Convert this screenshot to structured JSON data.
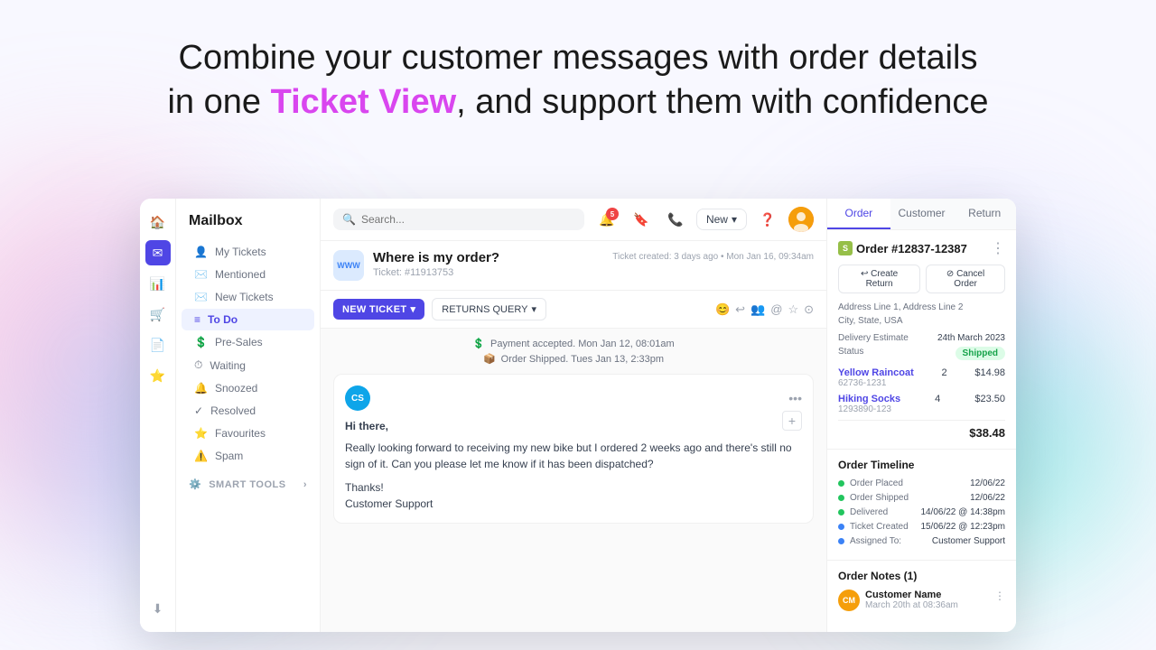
{
  "header": {
    "line1": "Combine your customer messages with order details",
    "line2_start": "in one ",
    "highlight": "Ticket View",
    "line2_end": ", and support them with confidence"
  },
  "sidebar": {
    "title": "Mailbox",
    "items": [
      {
        "id": "my-tickets",
        "label": "My Tickets",
        "icon": "👤"
      },
      {
        "id": "mentioned",
        "label": "Mentioned",
        "icon": "✉️"
      },
      {
        "id": "new-tickets",
        "label": "New Tickets",
        "icon": "✉️"
      },
      {
        "id": "to-do",
        "label": "To Do",
        "icon": "≡",
        "active": true
      },
      {
        "id": "pre-sales",
        "label": "Pre-Sales",
        "icon": "💲"
      },
      {
        "id": "waiting",
        "label": "Waiting",
        "icon": "⏱"
      },
      {
        "id": "snoozed",
        "label": "Snoozed",
        "icon": "🔔"
      },
      {
        "id": "resolved",
        "label": "Resolved",
        "icon": "✓"
      },
      {
        "id": "favourites",
        "label": "Favourites",
        "icon": "⭐"
      },
      {
        "id": "spam",
        "label": "Spam",
        "icon": "⚠️"
      }
    ],
    "smart_tools": "SMART TOOLS"
  },
  "topbar": {
    "search_placeholder": "Search...",
    "notification_count": "5",
    "new_button_label": "New"
  },
  "ticket": {
    "www_badge": "WWW",
    "title": "Where is my order?",
    "id": "Ticket: #11913753",
    "created": "Ticket created: 3 days ago",
    "date": "Mon Jan 16, 09:34am",
    "new_ticket_label": "NEW TICKET",
    "returns_query_label": "RETURNS QUERY",
    "timeline_events": [
      {
        "icon": "$",
        "text": "Payment accepted. Mon Jan 12, 08:01am"
      },
      {
        "icon": "📦",
        "text": "Order Shipped. Tues Jan 13, 2:33pm"
      }
    ],
    "message": {
      "sender_initials": "CS",
      "greeting": "Hi there,",
      "body": "Really looking forward to receiving my new bike but I ordered 2 weeks ago and there's still no sign of it. Can you please let me know if it has been dispatched?",
      "sign_off": "Thanks!",
      "signature": "Customer Support"
    }
  },
  "right_panel": {
    "tabs": [
      {
        "id": "order",
        "label": "Order",
        "active": true
      },
      {
        "id": "customer",
        "label": "Customer"
      },
      {
        "id": "return",
        "label": "Return"
      }
    ],
    "order": {
      "number": "Order #12837-12387",
      "create_return_label": "↩ Create Return",
      "cancel_order_label": "⊘ Cancel Order",
      "address_line1": "Address Line 1, Address Line 2",
      "address_line2": "City, State, USA",
      "delivery_estimate_label": "Delivery Estimate",
      "delivery_estimate_value": "24th March 2023",
      "status_label": "Status",
      "status_value": "Shipped",
      "items": [
        {
          "name": "Yellow Raincoat",
          "sku": "62736-1231",
          "qty": "2",
          "price": "$14.98"
        },
        {
          "name": "Hiking Socks",
          "sku": "1293890-123",
          "qty": "4",
          "price": "$23.50"
        }
      ],
      "total": "$38.48",
      "timeline_title": "Order Timeline",
      "timeline_rows": [
        {
          "label": "Order Placed",
          "value": "12/06/22",
          "color": "green"
        },
        {
          "label": "Order Shipped",
          "value": "12/06/22",
          "color": "green"
        },
        {
          "label": "Delivered",
          "value": "14/06/22 @ 14:38pm",
          "color": "green"
        },
        {
          "label": "Ticket Created",
          "value": "15/06/22 @ 12:23pm",
          "color": "blue"
        },
        {
          "label": "Assigned To:",
          "value": "Customer Support",
          "color": "blue"
        }
      ],
      "notes_title": "Order Notes (1)",
      "note": {
        "initials": "CM",
        "name": "Customer Name",
        "date": "March 20th at 08:36am"
      }
    }
  }
}
